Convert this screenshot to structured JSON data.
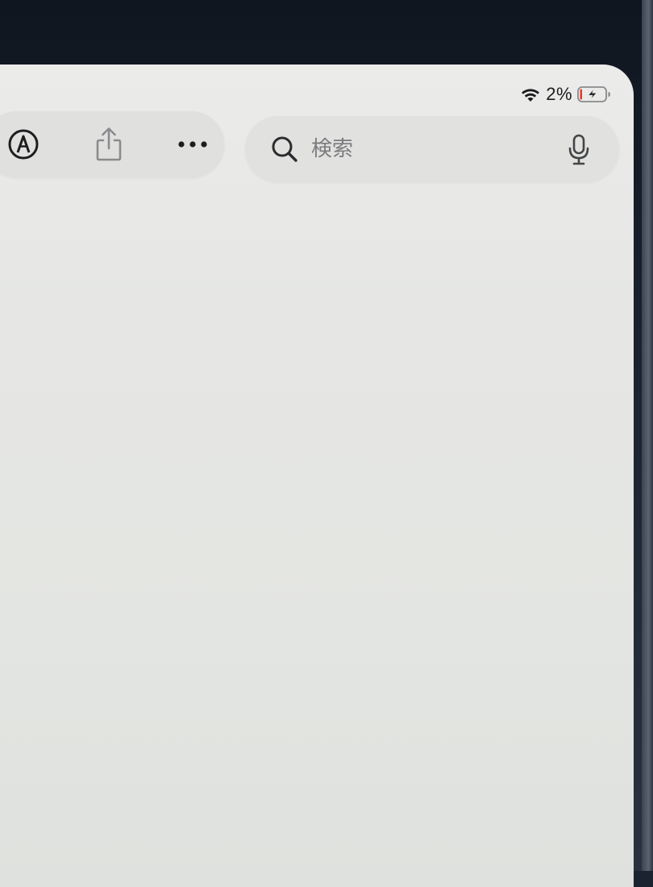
{
  "status_bar": {
    "battery_percent": "2%",
    "wifi_icon": "wifi-icon",
    "battery_icon": "battery-charging-icon",
    "battery_level": 0.02,
    "battery_low_color": "#e0372c"
  },
  "toolbar": {
    "icons": [
      "markup-icon",
      "share-icon",
      "more-icon"
    ]
  },
  "search": {
    "placeholder": "検索",
    "search_icon": "magnifier-icon",
    "mic_icon": "microphone-icon"
  }
}
